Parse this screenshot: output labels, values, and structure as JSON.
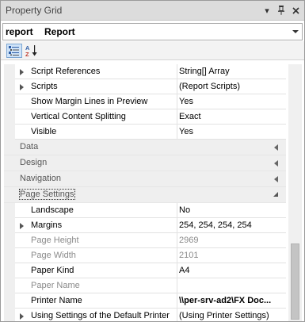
{
  "titlebar": {
    "title": "Property Grid",
    "menu_glyph": "▾",
    "pin_glyph": "📌",
    "close_glyph": "✕"
  },
  "object_selector": {
    "name": "report",
    "type": "Report"
  },
  "toolbar": {
    "categorized_icon": "categorized-icon",
    "alphabetical_icon": "sort-az-icon"
  },
  "rows_top": [
    {
      "name": "Script References",
      "value": "String[] Array",
      "expandable": true
    },
    {
      "name": "Scripts",
      "value": "(Report Scripts)",
      "expandable": true
    },
    {
      "name": "Show Margin Lines in Preview",
      "value": "Yes",
      "expandable": false
    },
    {
      "name": "Vertical Content Splitting",
      "value": "Exact",
      "expandable": false
    },
    {
      "name": "Visible",
      "value": "Yes",
      "expandable": false
    }
  ],
  "categories": [
    {
      "label": "Data",
      "state": "collapsed"
    },
    {
      "label": "Design",
      "state": "collapsed"
    },
    {
      "label": "Navigation",
      "state": "collapsed"
    },
    {
      "label": "Page Settings",
      "state": "expanded"
    }
  ],
  "page_settings_rows": [
    {
      "name": "Landscape",
      "value": "No",
      "expandable": false,
      "disabled": false,
      "bold": false
    },
    {
      "name": "Margins",
      "value": "254, 254, 254, 254",
      "expandable": true,
      "disabled": false,
      "bold": false
    },
    {
      "name": "Page Height",
      "value": "2969",
      "expandable": false,
      "disabled": true,
      "bold": false
    },
    {
      "name": "Page Width",
      "value": "2101",
      "expandable": false,
      "disabled": true,
      "bold": false
    },
    {
      "name": "Paper Kind",
      "value": "A4",
      "expandable": false,
      "disabled": false,
      "bold": false
    },
    {
      "name": "Paper Name",
      "value": "",
      "expandable": false,
      "disabled": true,
      "bold": false
    },
    {
      "name": "Printer Name",
      "value": "\\\\per-srv-ad2\\FX Doc...",
      "expandable": false,
      "disabled": false,
      "bold": true
    },
    {
      "name": "Using Settings of the Default Printer",
      "value": "(Using Printer Settings)",
      "expandable": true,
      "disabled": false,
      "bold": false
    }
  ]
}
